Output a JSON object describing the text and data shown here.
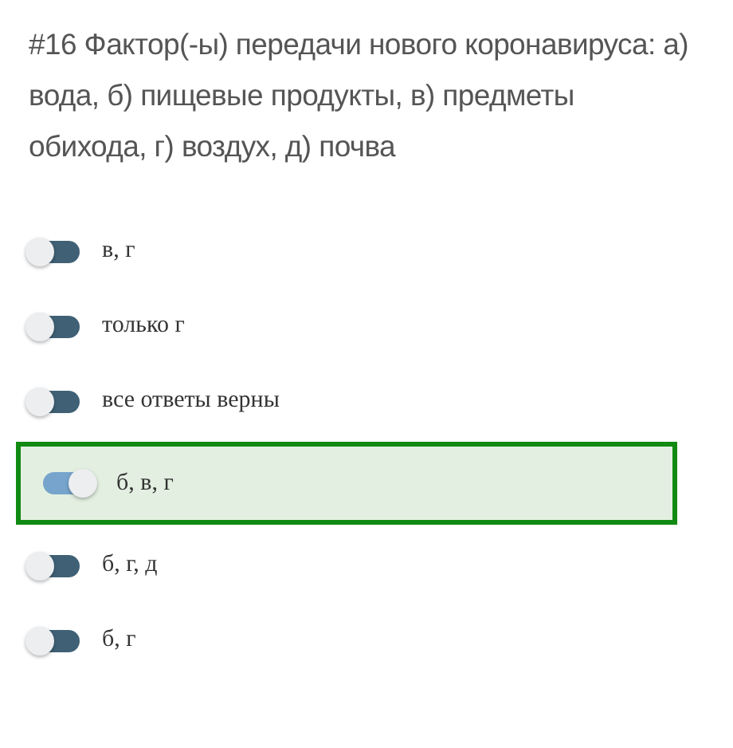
{
  "question": {
    "text": "#16 Фактор(-ы) передачи нового коронавируса: а) вода, б) пищевые продукты, в) предметы обихода, г) воздух, д) почва"
  },
  "options": [
    {
      "label": "в, г",
      "selected": false
    },
    {
      "label": "только г",
      "selected": false
    },
    {
      "label": "все ответы верны",
      "selected": false
    },
    {
      "label": "б, в, г",
      "selected": true
    },
    {
      "label": "б, г, д",
      "selected": false
    },
    {
      "label": "б, г",
      "selected": false
    }
  ]
}
